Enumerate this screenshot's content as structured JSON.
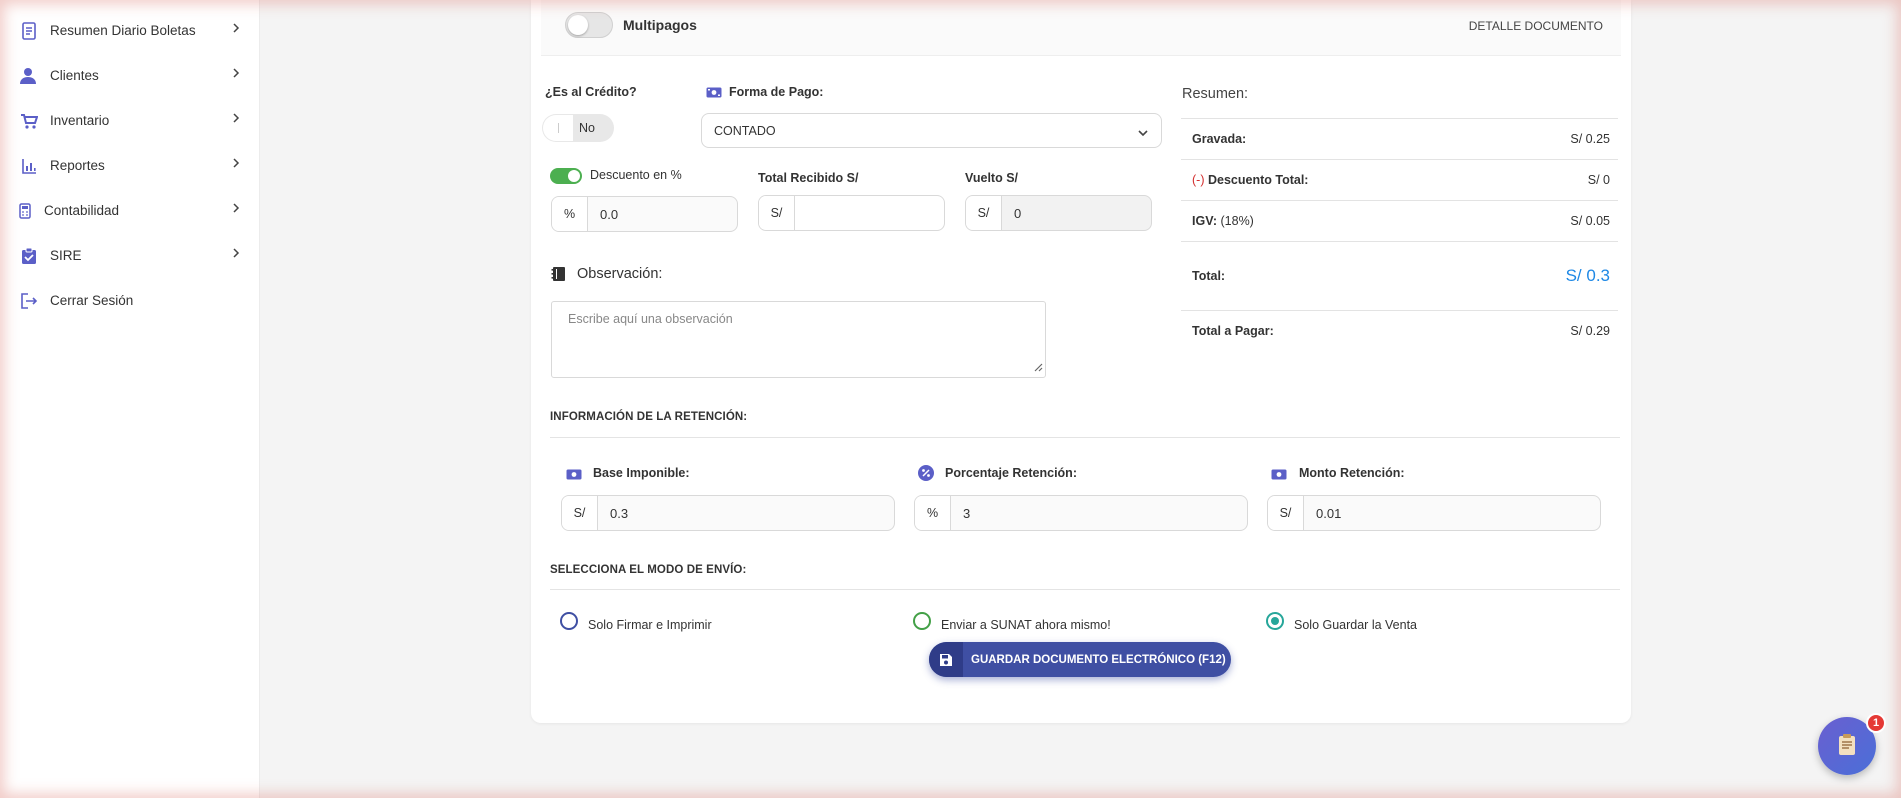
{
  "sidebar": {
    "items": [
      {
        "label": "Resumen Diario Boletas",
        "icon": "document-icon"
      },
      {
        "label": "Clientes",
        "icon": "users-icon"
      },
      {
        "label": "Inventario",
        "icon": "cart-icon"
      },
      {
        "label": "Reportes",
        "icon": "chart-icon"
      },
      {
        "label": "Contabilidad",
        "icon": "calculator-icon"
      },
      {
        "label": "SIRE",
        "icon": "clipboard-check-icon"
      },
      {
        "label": "Cerrar Sesión",
        "icon": "logout-icon"
      }
    ]
  },
  "header": {
    "multipagos_label": "Multipagos",
    "detalle_label": "DETALLE DOCUMENTO"
  },
  "form": {
    "credito_label": "¿Es al Crédito?",
    "credito_value": "No",
    "forma_pago_label": "Forma de Pago:",
    "forma_pago_value": "CONTADO",
    "descuento_label": "Descuento en %",
    "descuento_addon": "%",
    "descuento_value": "0.0",
    "total_recibido_label": "Total Recibido S/",
    "total_recibido_addon": "S/",
    "total_recibido_value": "",
    "vuelto_label": "Vuelto S/",
    "vuelto_addon": "S/",
    "vuelto_value": "0",
    "observacion_label": "Observación:",
    "observacion_placeholder": "Escribe aquí una observación"
  },
  "summary": {
    "title": "Resumen:",
    "gravada_label": "Gravada:",
    "gravada_value": "S/ 0.25",
    "descuento_prefix": "(-)",
    "descuento_label": "Descuento Total:",
    "descuento_value": "S/ 0",
    "igv_label": "IGV:",
    "igv_rate": "(18%)",
    "igv_value": "S/ 0.05",
    "total_label": "Total:",
    "total_value": "S/ 0.3",
    "total_pagar_label": "Total a Pagar:",
    "total_pagar_value": "S/ 0.29"
  },
  "retencion": {
    "section_title": "INFORMACIÓN DE LA RETENCIÓN:",
    "base_label": "Base Imponible:",
    "base_addon": "S/",
    "base_value": "0.3",
    "porcentaje_label": "Porcentaje Retención:",
    "porcentaje_addon": "%",
    "porcentaje_value": "3",
    "monto_label": "Monto Retención:",
    "monto_addon": "S/",
    "monto_value": "0.01"
  },
  "envio": {
    "section_title": "SELECCIONA EL MODO DE ENVÍO:",
    "options": [
      {
        "label": "Solo Firmar e Imprimir",
        "color": "#3f4fa3",
        "selected": false
      },
      {
        "label": "Enviar a SUNAT ahora mismo!",
        "color": "#43a047",
        "selected": false
      },
      {
        "label": "Solo Guardar la Venta",
        "color": "#26a69a",
        "selected": true
      }
    ],
    "save_label": "GUARDAR DOCUMENTO ELECTRÓNICO (F12)"
  },
  "fab": {
    "badge": "1",
    "icon": "receipt-icon"
  },
  "colors": {
    "accent": "#3f4fa3",
    "total_blue": "#1e88e5",
    "toggle_green": "#4caf50",
    "badge_red": "#e53935",
    "icon_purple": "#5b5fc7"
  }
}
